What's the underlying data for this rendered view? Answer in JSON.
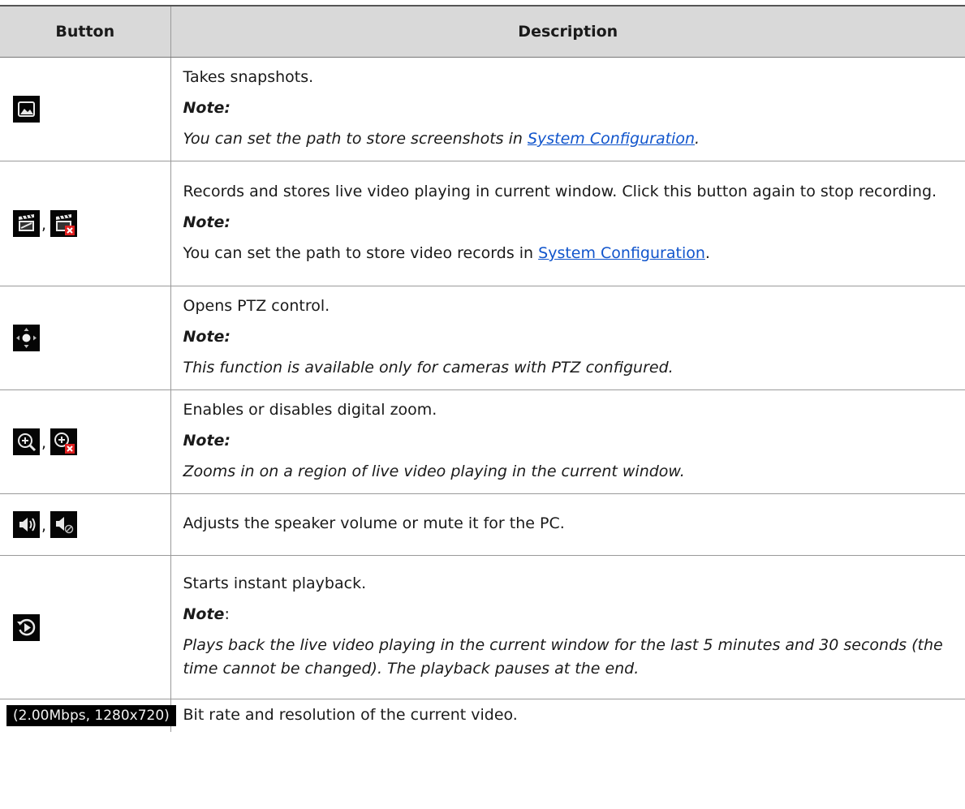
{
  "table": {
    "headers": {
      "button": "Button",
      "description": "Description"
    },
    "rows": [
      {
        "icons": [
          "snapshot-icon"
        ],
        "description": "Takes snapshots.",
        "note_label": "Note:",
        "note_pre": "You can set the path to store screenshots in ",
        "note_link": "System Configuration",
        "note_post": "."
      },
      {
        "icons": [
          "record-icon",
          "stop-record-icon"
        ],
        "separator": ",",
        "description": "Records and stores live video playing in current window. Click this button again to stop recording.",
        "note_label": "Note:",
        "note_pre": "You can set the path to store video records in ",
        "note_link": "System Configuration",
        "note_post": "."
      },
      {
        "icons": [
          "ptz-icon"
        ],
        "description": "Opens PTZ control.",
        "note_label": "Note:",
        "note_text": "This function is available only for cameras with PTZ configured."
      },
      {
        "icons": [
          "zoom-in-icon",
          "zoom-disable-icon"
        ],
        "separator": ",",
        "description": "Enables or disables digital zoom.",
        "note_label": "Note:",
        "note_text": "Zooms in on a region of live video playing in the current window."
      },
      {
        "icons": [
          "speaker-icon",
          "mute-icon"
        ],
        "separator": ",",
        "description": "Adjusts the speaker volume or mute it for the PC."
      },
      {
        "icons": [
          "instant-playback-icon"
        ],
        "description": "Starts instant playback.",
        "note_label": "Note",
        "note_suffix": ":",
        "note_text": "Plays back the live video playing in the current window for the last 5 minutes and 30 seconds (the time cannot be changed). The playback pauses at the end."
      },
      {
        "bitrate_label": "(2.00Mbps, 1280x720)",
        "description": "Bit rate and resolution of the current video."
      }
    ]
  },
  "colors": {
    "header_bg": "#d9d9d9",
    "icon_bg": "#050505",
    "link": "#1155cc",
    "border": "#9a9a9a"
  }
}
